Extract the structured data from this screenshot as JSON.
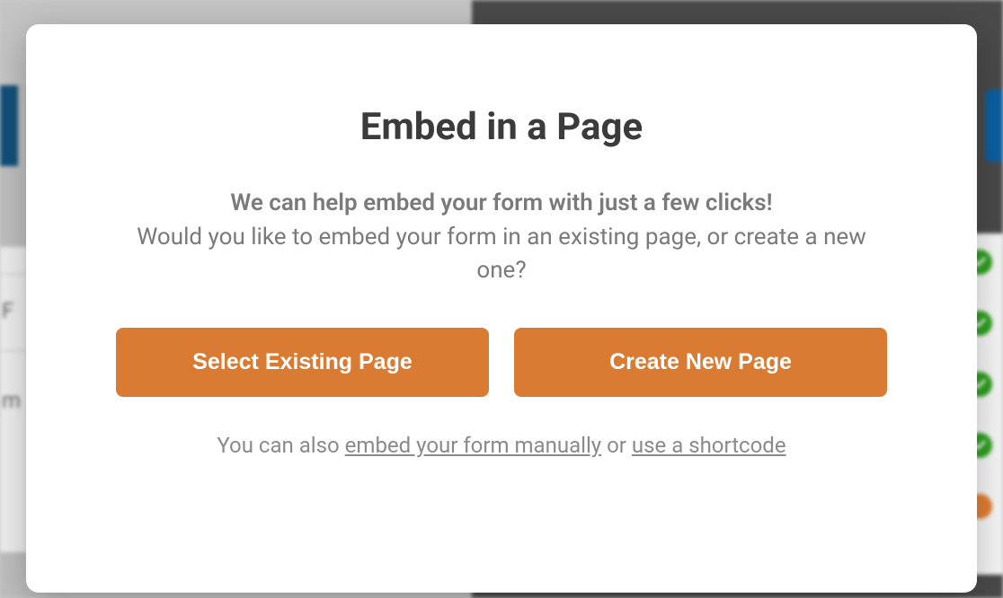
{
  "modal": {
    "title": "Embed in a Page",
    "lead": "We can help embed your form with just a few clicks!",
    "sub": "Would you like to embed your form in an existing page, or create a new one?",
    "buttons": {
      "select_existing": "Select Existing Page",
      "create_new": "Create New Page"
    },
    "footer": {
      "prefix": "You can also ",
      "link_manual": "embed your form manually",
      "mid": " or ",
      "link_shortcode": "use a shortcode"
    }
  },
  "bg": {
    "left_text1": "F",
    "left_text2": "m"
  }
}
